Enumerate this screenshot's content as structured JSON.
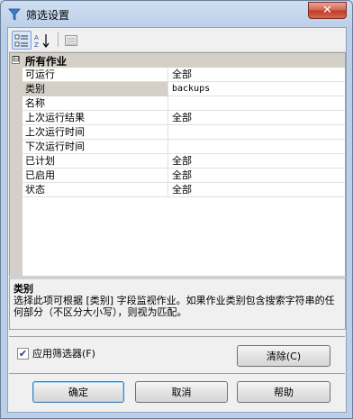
{
  "window": {
    "title": "筛选设置",
    "close_glyph": "✕"
  },
  "toolbar": {
    "buttons": [
      {
        "name": "categorized-view-icon"
      },
      {
        "name": "alphabetical-sort-icon"
      },
      {
        "name": "property-pages-icon"
      }
    ]
  },
  "grid": {
    "category": {
      "toggle": "⊟",
      "label": "所有作业"
    },
    "rows": [
      {
        "name": "可运行",
        "value": "全部"
      },
      {
        "name": "类别",
        "value": "backups"
      },
      {
        "name": "名称",
        "value": ""
      },
      {
        "name": "上次运行结果",
        "value": "全部"
      },
      {
        "name": "上次运行时间",
        "value": ""
      },
      {
        "name": "下次运行时间",
        "value": ""
      },
      {
        "name": "已计划",
        "value": "全部"
      },
      {
        "name": "已启用",
        "value": "全部"
      },
      {
        "name": "状态",
        "value": "全部"
      }
    ]
  },
  "help": {
    "title": "类别",
    "description": "选择此项可根据 [类别] 字段监视作业。如果作业类别包含搜索字符串的任何部分（不区分大小写），则视为匹配。"
  },
  "options": {
    "apply_filter_label": "应用筛选器(F)",
    "apply_filter_checked": true,
    "clear_label": "清除(C)"
  },
  "buttons": {
    "ok": "确定",
    "cancel": "取消",
    "help": "帮助"
  }
}
